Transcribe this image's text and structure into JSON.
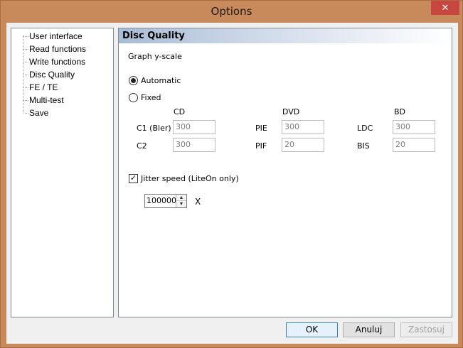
{
  "window": {
    "title": "Options",
    "close_glyph": "✕"
  },
  "tree": {
    "items": [
      {
        "label": "User interface"
      },
      {
        "label": "Read functions"
      },
      {
        "label": "Write functions"
      },
      {
        "label": "Disc Quality",
        "selected": true
      },
      {
        "label": "FE / TE"
      },
      {
        "label": "Multi-test"
      },
      {
        "label": "Save"
      }
    ]
  },
  "panel": {
    "header": "Disc Quality",
    "graph_label": "Graph y-scale",
    "radio_automatic": {
      "label": "Automatic",
      "checked": true
    },
    "radio_fixed": {
      "label": "Fixed",
      "checked": false
    },
    "columns": {
      "cd": "CD",
      "dvd": "DVD",
      "bd": "BD"
    },
    "cd": {
      "c1_label": "C1 (Bler)",
      "c1_value": "300",
      "c2_label": "C2",
      "c2_value": "300"
    },
    "dvd": {
      "pie_label": "PIE",
      "pie_value": "300",
      "pif_label": "PIF",
      "pif_value": "20"
    },
    "bd": {
      "ldc_label": "LDC",
      "ldc_value": "300",
      "bis_label": "BIS",
      "bis_value": "20"
    },
    "jitter": {
      "label": "Jitter speed (LiteOn only)",
      "checked": true,
      "check_glyph": "✓"
    },
    "speed": {
      "value": "100000",
      "unit": "X",
      "up_glyph": "▲",
      "down_glyph": "▼"
    }
  },
  "buttons": {
    "ok": "OK",
    "cancel": "Anuluj",
    "apply": "Zastosuj"
  }
}
